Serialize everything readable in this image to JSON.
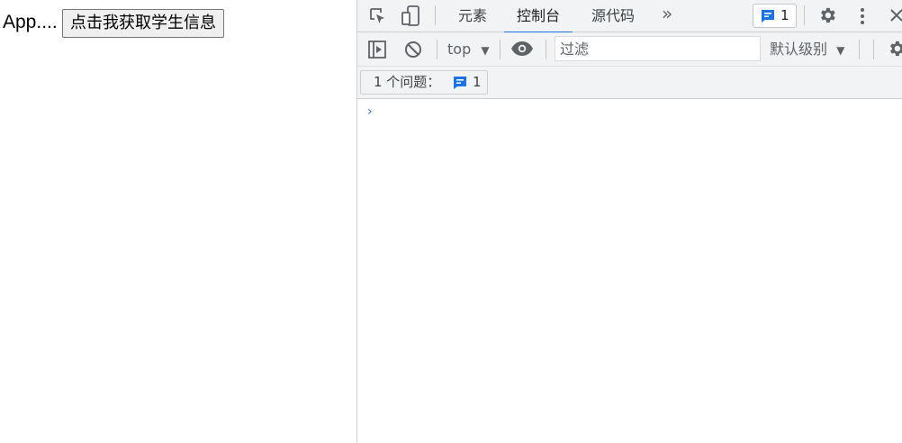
{
  "page": {
    "app_text": "App....",
    "fetch_button_label": "点击我获取学生信息"
  },
  "devtools": {
    "tabs": [
      {
        "label": "元素",
        "active": false
      },
      {
        "label": "控制台",
        "active": true
      },
      {
        "label": "源代码",
        "active": false
      }
    ],
    "more_tabs_label": "»",
    "issues_badge_count": "1",
    "toolbar": {
      "context": "top",
      "filter_placeholder": "过滤",
      "levels_label": "默认级别"
    },
    "issues_bar": {
      "label": "1 个问题：",
      "count": "1"
    },
    "console_prompt": "›"
  },
  "colors": {
    "accent": "#1a73e8",
    "toolbar_bg": "#f1f3f4",
    "icon": "#5f6368"
  }
}
